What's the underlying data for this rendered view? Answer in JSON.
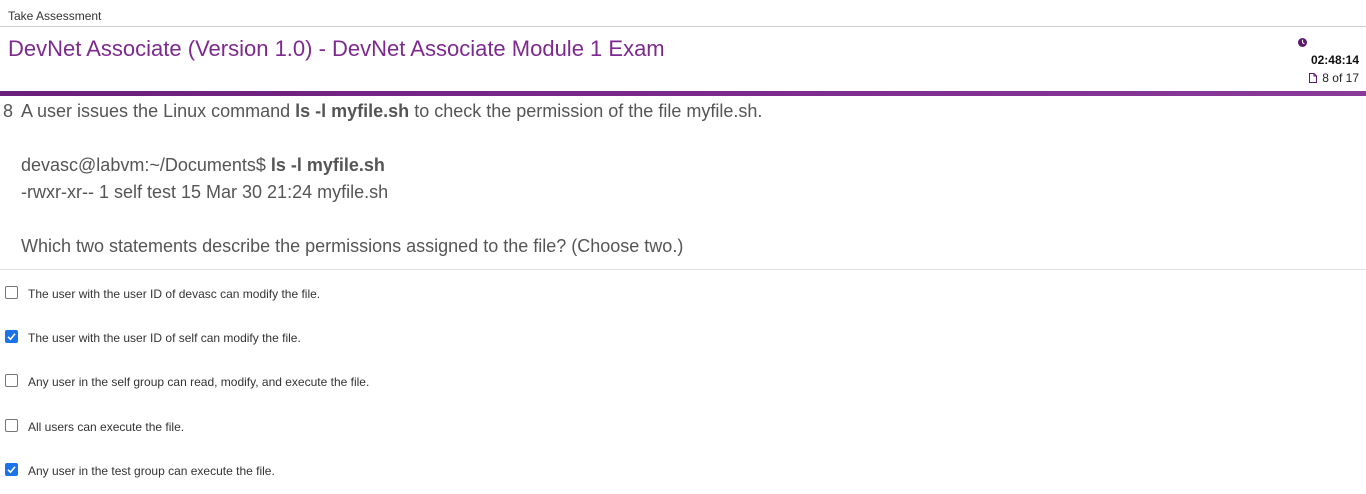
{
  "breadcrumb": "Take Assessment",
  "exam_title": "DevNet Associate (Version 1.0) - DevNet Associate Module 1 Exam",
  "timer": {
    "time_remaining": "02:48:14",
    "progress": "8 of 17",
    "icon": "clock-icon",
    "progress_icon": "page-icon"
  },
  "accent_color": "#7b2a8c",
  "question": {
    "number": "8",
    "stem_before": "A user issues the Linux command ",
    "stem_command": "ls -l myfile.sh",
    "stem_after": " to check the permission of the file myfile.sh.",
    "prompt_text": "devasc@labvm:~/Documents$ ",
    "prompt_command": "ls -l myfile.sh",
    "output_line": "-rwxr-xr-- 1 self test 15 Mar 30 21:24 myfile.sh",
    "ask": "Which two statements describe the permissions assigned to the file? (Choose two.)"
  },
  "options": [
    {
      "label": "The user with the user ID of devasc can modify the file.",
      "checked": false
    },
    {
      "label": "The user with the user ID of self can modify the file.",
      "checked": true
    },
    {
      "label": "Any user in the self group can read, modify, and execute the file.",
      "checked": false
    },
    {
      "label": "All users can execute the file.",
      "checked": false
    },
    {
      "label": "Any user in the test group can execute the file.",
      "checked": true
    }
  ]
}
